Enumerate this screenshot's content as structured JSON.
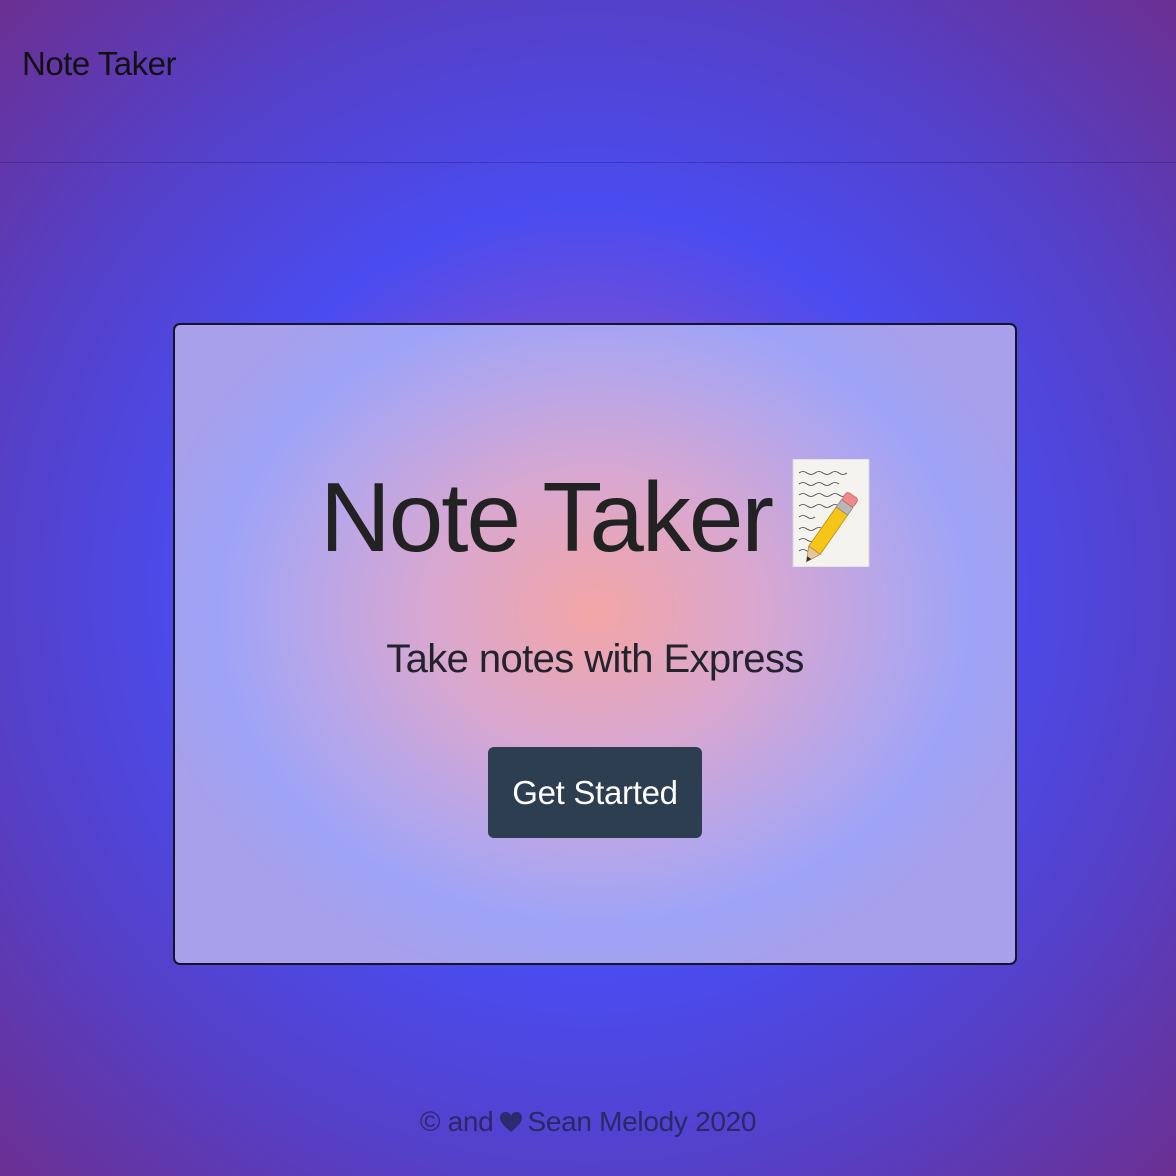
{
  "navbar": {
    "brand": "Note Taker"
  },
  "hero": {
    "title": "Note Taker",
    "title_icon": "memo-icon",
    "subtitle": "Take notes with Express",
    "cta_label": "Get Started"
  },
  "footer": {
    "copyright_symbol": "©",
    "and_text": "and",
    "heart_icon": "heart-icon",
    "author_text": "Sean Melody 2020"
  },
  "colors": {
    "button_bg": "#2c3e50",
    "button_text": "#ffffff",
    "heart": "#2d2a6e"
  }
}
